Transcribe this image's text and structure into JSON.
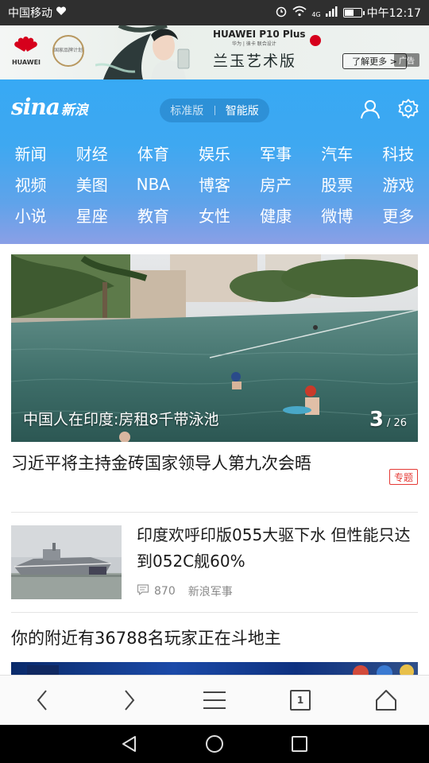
{
  "status_bar": {
    "carrier": "中国移动",
    "network": "4G",
    "battery_level": 0.5,
    "time": "中午12:17"
  },
  "ad": {
    "brand": "HUAWEI",
    "seal_text": "国家品牌计划",
    "product": "HUAWEI P10 Plus",
    "product_sub": "华为 | 徕卡 联合设计",
    "slogan": "兰玉艺术版",
    "cta": "了解更多 >",
    "tag": "广告"
  },
  "header": {
    "logo_word": "sina",
    "logo_cn": "新浪",
    "mode_standard": "标准版",
    "mode_smart": "智能版",
    "user_icon": "user-icon",
    "settings_icon": "gear-icon"
  },
  "nav": {
    "items": [
      "新闻",
      "财经",
      "体育",
      "娱乐",
      "军事",
      "汽车",
      "科技",
      "视频",
      "美图",
      "NBA",
      "博客",
      "房产",
      "股票",
      "游戏",
      "小说",
      "星座",
      "教育",
      "女性",
      "健康",
      "微博",
      "更多"
    ]
  },
  "feed": {
    "hero": {
      "caption": "中国人在印度:房租8千带泳池",
      "current": "3",
      "total": "/ 26"
    },
    "headline": {
      "text": "习近平将主持金砖国家领导人第九次会晤",
      "badge": "专题"
    },
    "news": {
      "title": "印度欢呼印版055大驱下水 但性能只达到052C舰60%",
      "comments": "870",
      "source": "新浪军事"
    },
    "promo": {
      "title": "你的附近有36788名玩家正在斗地主"
    }
  },
  "browser_bar": {
    "tab_count": "1"
  },
  "colors": {
    "header_blue": "#37a9f4",
    "badge_red": "#e53935"
  }
}
